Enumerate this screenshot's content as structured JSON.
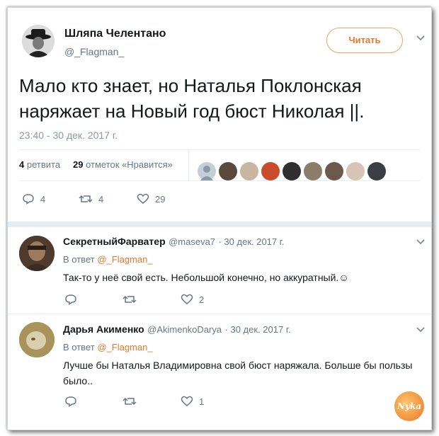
{
  "tweet": {
    "author_name": "Шляпа Челентано",
    "author_handle": "@_Flagman_",
    "follow_label": "Читать",
    "text_line1": "Мало кто знает, но Наталья Поклонская",
    "text_line2": "наряжает на Новый год бюст Николая ||.",
    "timestamp": "23:40 - 30 дек. 2017 г.",
    "retweets_count": "4",
    "retweets_label": "ретвита",
    "likes_count": "29",
    "likes_label": "отметок «Нравится»",
    "actions": {
      "reply_count": "4",
      "retweet_count": "4",
      "like_count": "29"
    }
  },
  "replies": [
    {
      "author_name": "СекретныйФарватер",
      "author_handle": "@maseva7",
      "date": "· 30 дек. 2017 г.",
      "in_reply_prefix": "В ответ",
      "in_reply_to": "@_Flagman_",
      "text": "Так-то у неё свой есть. Небольшой конечно, но аккуратный.☺",
      "like_count": "2"
    },
    {
      "author_name": "Дарья Акименко",
      "author_handle": "@AkimenkoDarya",
      "date": "· 30 дек. 2017 г.",
      "in_reply_prefix": "В ответ",
      "in_reply_to": "@_Flagman_",
      "text_line1": "Лучше бы Наталья Владимировна свой бюст наряжала. Больше бы пользы",
      "text_line2": "было..",
      "like_count": "1"
    }
  ],
  "watermark": "Nyka",
  "colors": {
    "accent": "#e07a2e",
    "text": "#14171a",
    "muted": "#657786"
  }
}
